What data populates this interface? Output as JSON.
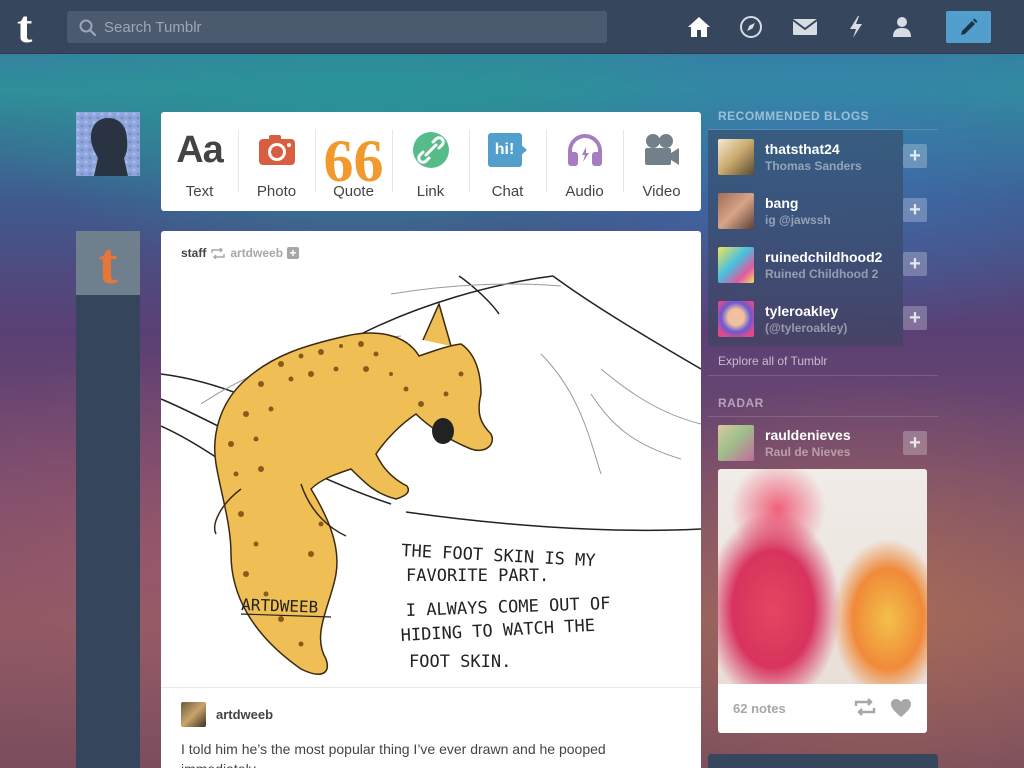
{
  "header": {
    "logo": "t",
    "search_placeholder": "Search Tumblr"
  },
  "icons": {
    "home": "home-icon",
    "explore": "compass-icon",
    "inbox": "envelope-icon",
    "activity": "lightning-icon",
    "account": "person-icon",
    "compose": "pencil-icon"
  },
  "staff_avatar_letter": "t",
  "post_types": [
    {
      "label": "Text",
      "icon": "Aa",
      "color": "#444444"
    },
    {
      "label": "Photo",
      "color": "#d95e40"
    },
    {
      "label": "Quote",
      "icon": "66",
      "color": "#f2992e"
    },
    {
      "label": "Link",
      "color": "#56bc8a"
    },
    {
      "label": "Chat",
      "icon": "hi!",
      "color": "#529ecc"
    },
    {
      "label": "Audio",
      "color": "#a77dc2"
    },
    {
      "label": "Video",
      "color": "#748089"
    }
  ],
  "post": {
    "poster": "staff",
    "reblogged_from": "artdweeb",
    "follow": "+",
    "reblog_author": "artdweeb",
    "caption_lines": [
      "THE  FOOT  SKIN  IS  MY",
      "FAVORITE  PART.",
      "I  ALWAYS  COME  OUT OF",
      "HIDING  TO  WATCH  THE",
      "FOOT  SKIN."
    ],
    "signature": "ARTDWEEB",
    "text": "I told him he’s the most popular thing I’ve ever drawn and he pooped immediately."
  },
  "sidebar": {
    "recommended_title": "RECOMMENDED BLOGS",
    "recommended": [
      {
        "name": "thatsthat24",
        "sub": "Thomas Sanders",
        "follow": "+"
      },
      {
        "name": "bang",
        "sub": "ig @jawssh",
        "follow": "+"
      },
      {
        "name": "ruinedchildhood2",
        "sub": "Ruined Childhood 2",
        "follow": "+"
      },
      {
        "name": "tyleroakley",
        "sub": "(@tyleroakley)",
        "follow": "+"
      }
    ],
    "explore_link": "Explore all of Tumblr",
    "radar_title": "RADAR",
    "radar_blog": {
      "name": "rauldenieves",
      "sub": "Raul de Nieves",
      "follow": "+"
    },
    "radar_notes": "62 notes"
  },
  "colors": {
    "topbar": "#36465d",
    "compose": "#529ecc"
  }
}
